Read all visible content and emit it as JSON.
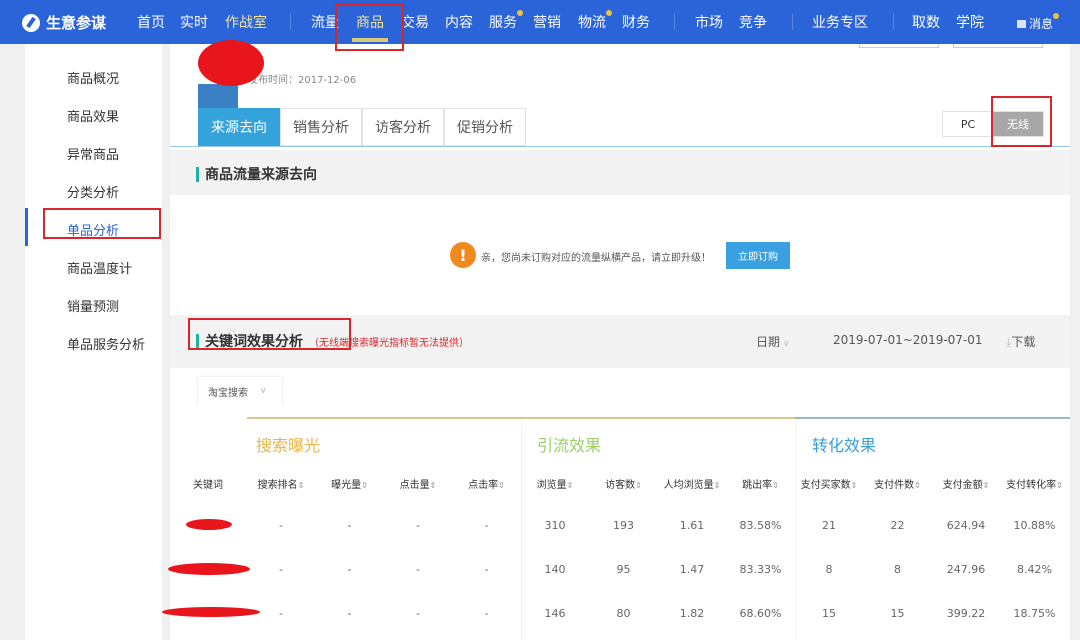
{
  "nav": {
    "brand": "生意参谋",
    "items": [
      {
        "label": "首页"
      },
      {
        "label": "实时"
      },
      {
        "label": "作战室"
      },
      {
        "label": "流量"
      },
      {
        "label": "商品"
      },
      {
        "label": "交易"
      },
      {
        "label": "内容"
      },
      {
        "label": "服务"
      },
      {
        "label": "营销"
      },
      {
        "label": "物流"
      },
      {
        "label": "财务"
      },
      {
        "label": "市场"
      },
      {
        "label": "竞争"
      },
      {
        "label": "业务专区"
      },
      {
        "label": "取数"
      },
      {
        "label": "学院"
      },
      {
        "label": "消息"
      }
    ],
    "active": "商品"
  },
  "sidebar": {
    "items": [
      {
        "label": "商品概况"
      },
      {
        "label": "商品效果"
      },
      {
        "label": "异常商品"
      },
      {
        "label": "分类分析"
      },
      {
        "label": "单品分析"
      },
      {
        "label": "商品温度计"
      },
      {
        "label": "销量预测"
      },
      {
        "label": "单品服务分析"
      }
    ],
    "active": "单品分析"
  },
  "product": {
    "publish_time": "发布时间：2017-12-06"
  },
  "tabs": [
    {
      "label": "来源去向"
    },
    {
      "label": "销售分析"
    },
    {
      "label": "访客分析"
    },
    {
      "label": "促销分析"
    }
  ],
  "device": {
    "pc": "PC",
    "wireless": "无线",
    "active": "无线"
  },
  "source_section": {
    "title": "商品流量来源去向",
    "notice": "亲，您尚未订购对应的流量纵横产品，请立即升级！",
    "subscribe_button": "立即订购"
  },
  "keyword_section": {
    "title": "关键词效果分析",
    "note": "（无线端搜索曝光指标暂无法提供）",
    "date_label": "日期",
    "date_range": "2019-07-01~2019-07-01",
    "download": "下载",
    "source_select": "淘宝搜索"
  },
  "table": {
    "groups": [
      {
        "label": "搜索曝光",
        "color": "#e8b64a"
      },
      {
        "label": "引流效果",
        "color": "#9ccf6a"
      },
      {
        "label": "转化效果",
        "color": "#3c9ed8"
      }
    ],
    "columns": [
      "关键词",
      "搜索排名",
      "曝光量",
      "点击量",
      "点击率",
      "浏览量",
      "访客数",
      "人均浏览量",
      "跳出率",
      "支付买家数",
      "支付件数",
      "支付金额",
      "支付转化率"
    ],
    "rows": [
      [
        "-",
        "-",
        "-",
        "-",
        "310",
        "193",
        "1.61",
        "83.58%",
        "21",
        "22",
        "624.94",
        "10.88%"
      ],
      [
        "-",
        "-",
        "-",
        "-",
        "140",
        "95",
        "1.47",
        "83.33%",
        "8",
        "8",
        "247.96",
        "8.42%"
      ],
      [
        "-",
        "-",
        "-",
        "-",
        "146",
        "80",
        "1.82",
        "68.60%",
        "15",
        "15",
        "399.22",
        "18.75%"
      ]
    ]
  }
}
